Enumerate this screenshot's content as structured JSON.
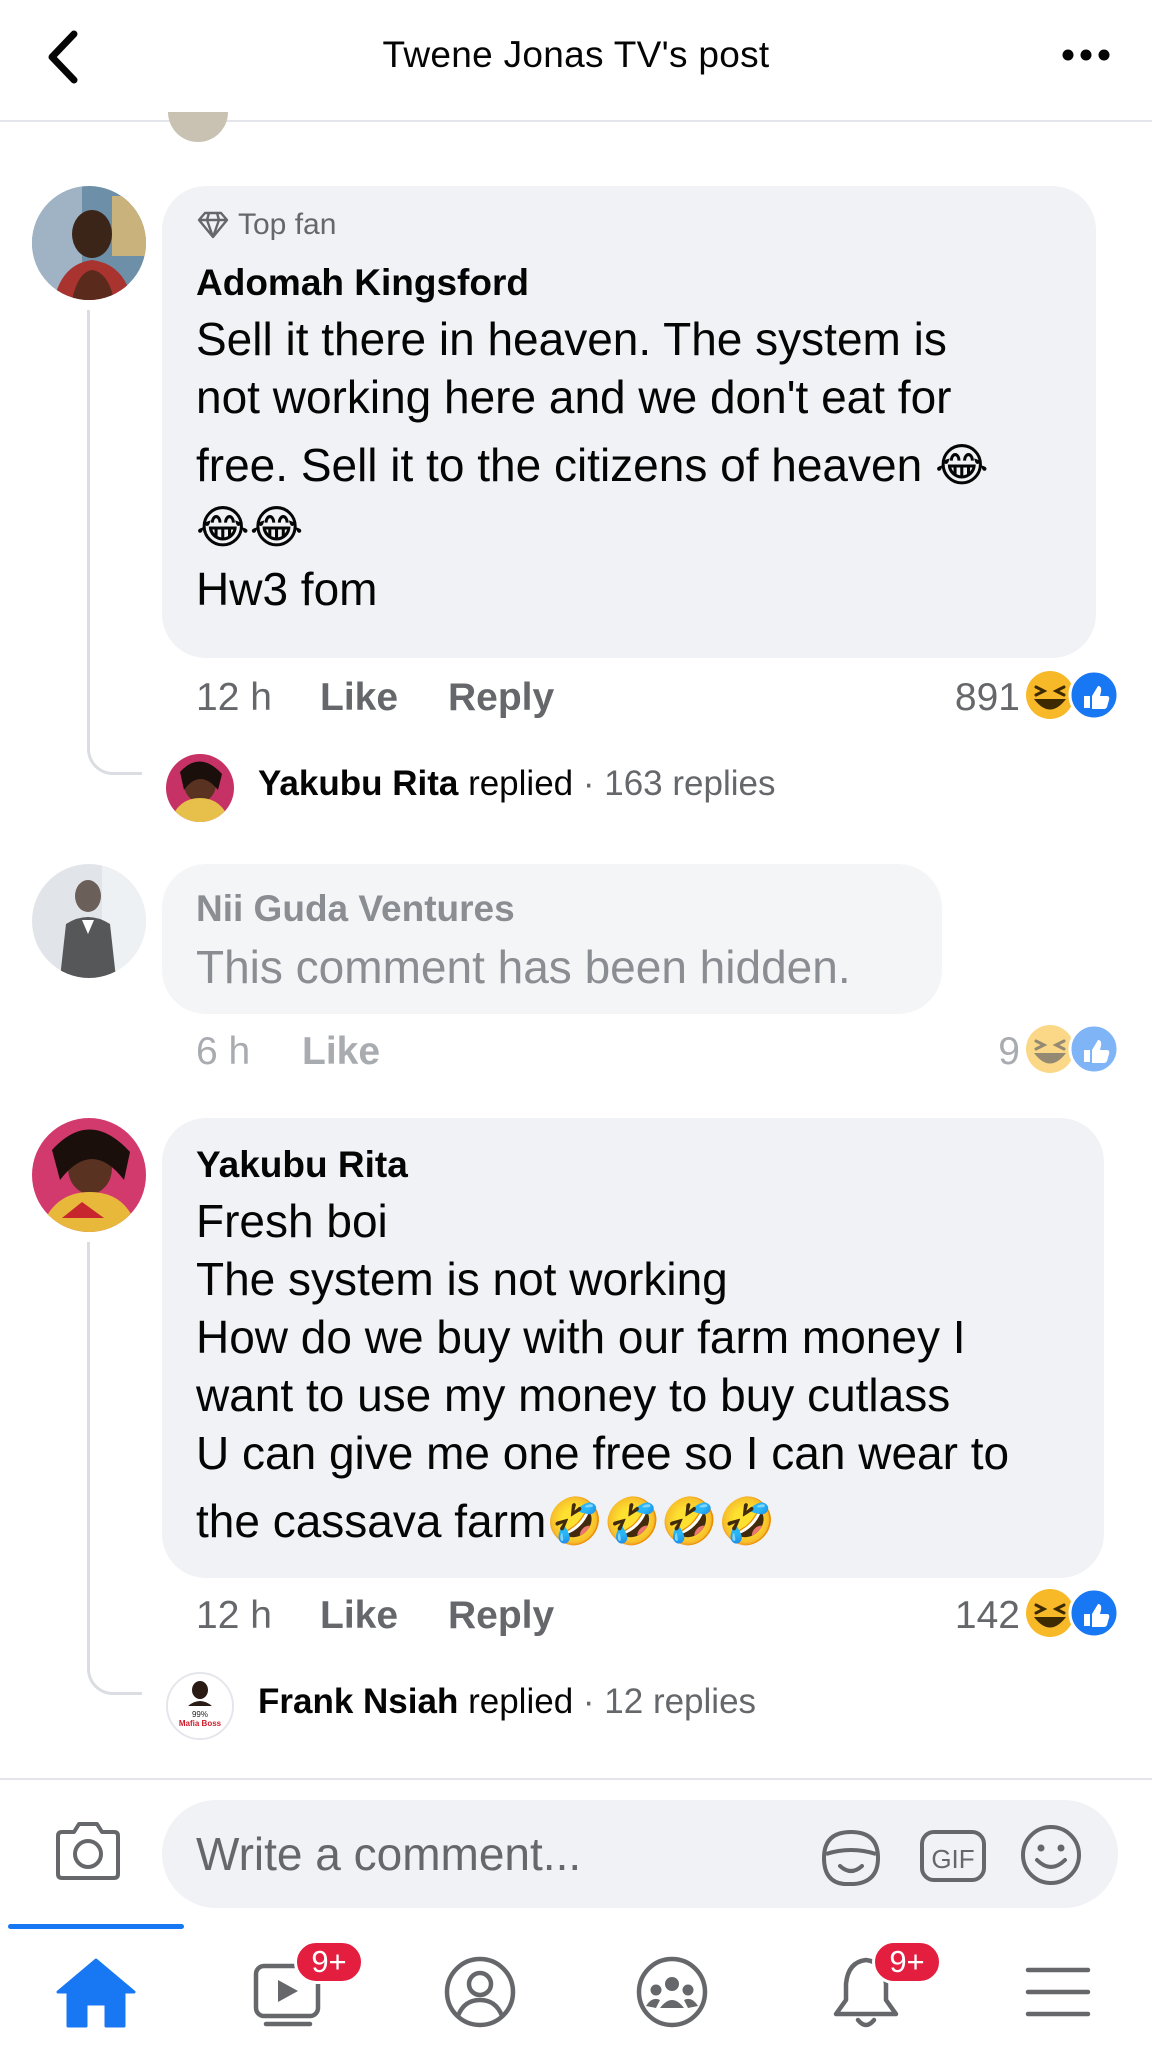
{
  "header": {
    "title": "Twene Jonas TV's post"
  },
  "comments": [
    {
      "badge": "Top fan",
      "author": "Adomah Kingsford",
      "lines": [
        "Sell it there in heaven. The system is",
        "not working here and we don't eat for",
        "free. Sell it to the citizens of heaven 😂",
        "😂😂",
        "Hw3 fom"
      ],
      "time": "12 h",
      "like_label": "Like",
      "reply_label": "Reply",
      "reactions": "891",
      "reaction_icons": [
        "laugh-icon",
        "like-icon"
      ],
      "replied_name": "Yakubu Rita",
      "replied_word": "replied",
      "replies_count": "· 163 replies"
    },
    {
      "author": "Nii Guda Ventures",
      "text": "This comment has been hidden.",
      "time": "6 h",
      "like_label": "Like",
      "reactions": "9",
      "reaction_icons": [
        "laugh-icon",
        "like-icon"
      ]
    },
    {
      "author": "Yakubu Rita",
      "lines": [
        "Fresh boi",
        "The system is not working",
        "How do we buy with our farm money I",
        "want to use my money to buy cutlass",
        "U can give me one free so I can wear to",
        "the cassava farm🤣🤣🤣🤣"
      ],
      "time": "12 h",
      "like_label": "Like",
      "reply_label": "Reply",
      "reactions": "142",
      "reaction_icons": [
        "laugh-icon",
        "like-icon"
      ],
      "replied_name": "Frank Nsiah",
      "replied_word": "replied",
      "replies_count": "· 12 replies",
      "reply_avatar_text": [
        "99%",
        "Mafia Boss"
      ]
    }
  ],
  "composer": {
    "placeholder": "Write a comment...",
    "gif_label": "GIF"
  },
  "nav": {
    "video_badge": "9+",
    "notifications_badge": "9+",
    "active": "home"
  },
  "colors": {
    "accent": "#1877f2",
    "badge": "#e41e3f",
    "bubble": "#f0f2f5"
  }
}
